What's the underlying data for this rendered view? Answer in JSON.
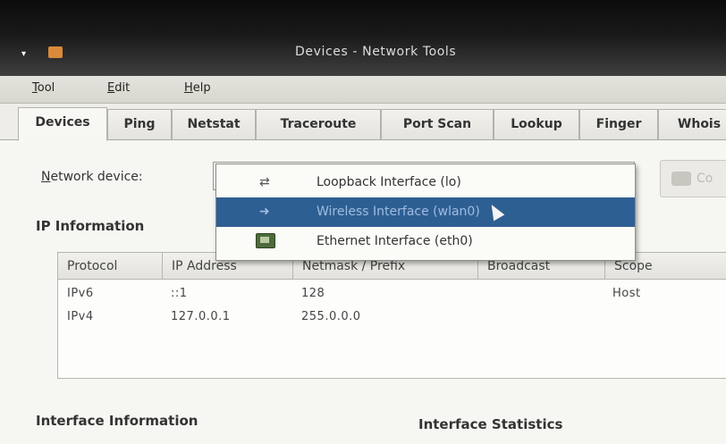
{
  "window": {
    "title": "Devices - Network Tools",
    "menu": [
      {
        "mnemonic": "T",
        "rest": "ool"
      },
      {
        "mnemonic": "E",
        "rest": "dit"
      },
      {
        "mnemonic": "H",
        "rest": "elp"
      }
    ]
  },
  "tabs": [
    "Devices",
    "Ping",
    "Netstat",
    "Traceroute",
    "Port Scan",
    "Lookup",
    "Finger",
    "Whois"
  ],
  "active_tab": "Devices",
  "device_row": {
    "label_mnemonic": "N",
    "label_rest": "etwork device:",
    "configure_label": "Co"
  },
  "dropdown": {
    "items": [
      {
        "label": "Loopback Interface (lo)",
        "icon": "loopback-icon",
        "glyph": "⇄"
      },
      {
        "label": "Wireless Interface (wlan0)",
        "icon": "wireless-icon",
        "glyph": "➜"
      },
      {
        "label": "Ethernet Interface (eth0)",
        "icon": "ethernet-icon",
        "glyph": ""
      }
    ],
    "selected_index": 1
  },
  "ip_section": {
    "title": "IP Information",
    "columns": [
      "Protocol",
      "IP Address",
      "Netmask / Prefix",
      "Broadcast",
      "Scope"
    ],
    "rows": [
      {
        "protocol": "IPv6",
        "ip": "::1",
        "netmask": "128",
        "broadcast": "",
        "scope": "Host"
      },
      {
        "protocol": "IPv4",
        "ip": "127.0.0.1",
        "netmask": "255.0.0.0",
        "broadcast": "",
        "scope": ""
      }
    ]
  },
  "interface_information_title": "Interface Information",
  "interface_statistics_title": "Interface Statistics",
  "colors": {
    "selection": "#2e5f93",
    "titlebar": "#1a1a1a",
    "window_bg": "#f6f6f2"
  }
}
